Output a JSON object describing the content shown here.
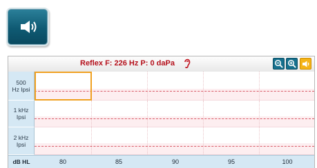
{
  "speaker_button": {
    "icon": "speaker-icon"
  },
  "reflex_panel": {
    "title": "Reflex  F: 226 Hz P: 0 daPa",
    "ear_icon": "ear-icon",
    "toolbar": {
      "zoom_out_icon": "zoom-out-icon",
      "zoom_in_icon": "zoom-in-icon",
      "speaker_icon": "speaker-icon"
    },
    "rows": [
      {
        "label_line1": "500",
        "label_line2": "Hz Ipsi"
      },
      {
        "label_line1": "1 kHz",
        "label_line2": "Ipsi"
      },
      {
        "label_line1": "2 kHz",
        "label_line2": "Ipsi"
      }
    ],
    "axis": {
      "unit": "dB HL",
      "ticks": [
        "80",
        "85",
        "90",
        "95",
        "100"
      ]
    },
    "colors": {
      "title": "#b40f1a",
      "label_bg": "#d5e8f4",
      "plot_bg": "#fdeef0",
      "threshold_dash": "#d85a66",
      "selection": "#f0a020",
      "accent_teal": "#16708d",
      "accent_orange": "#f4b418"
    }
  }
}
